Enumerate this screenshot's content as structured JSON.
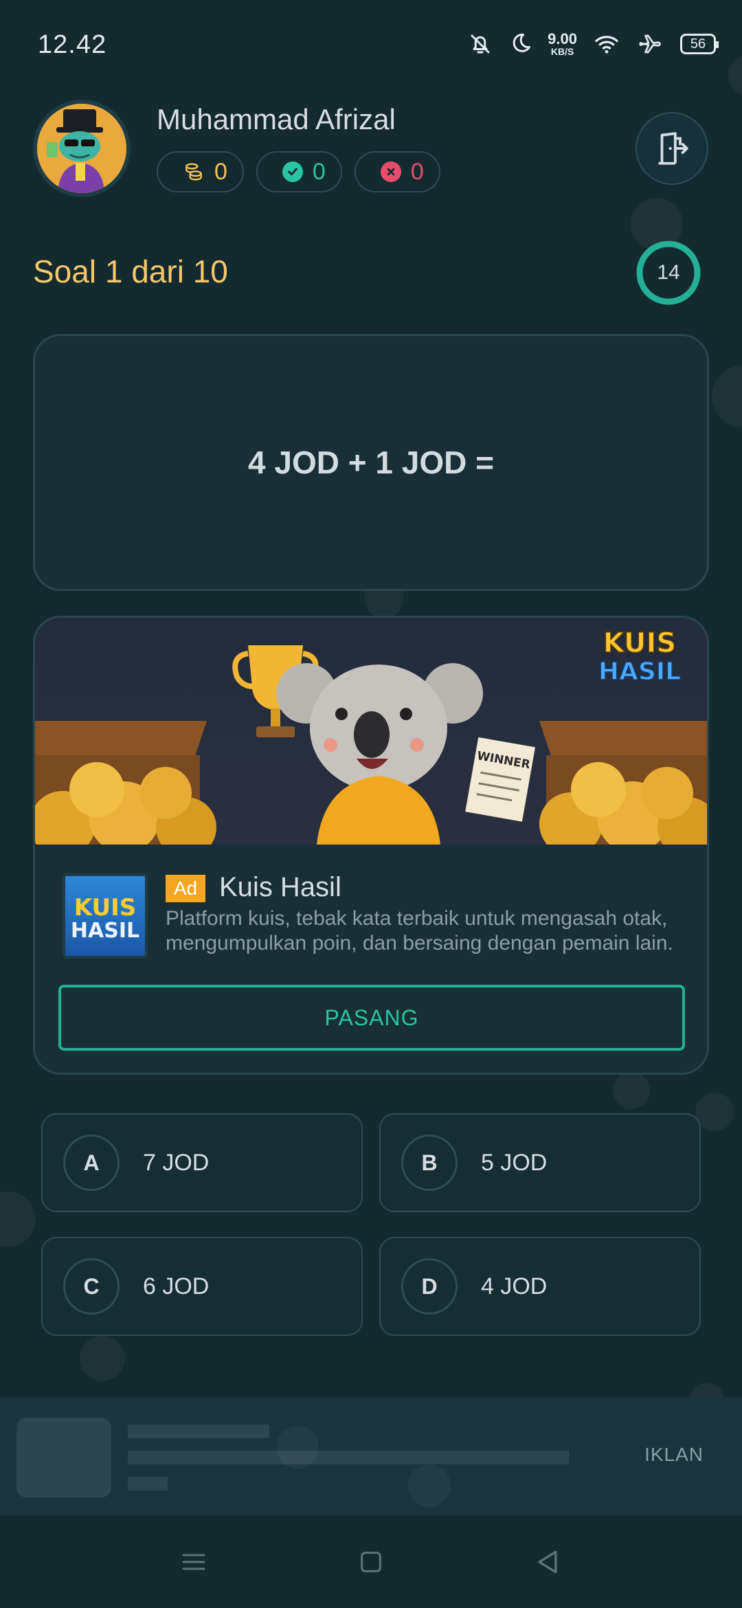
{
  "status_bar": {
    "time": "12.42",
    "net_speed_value": "9.00",
    "net_speed_unit": "KB/S",
    "battery": "56"
  },
  "profile": {
    "name": "Muhammad Afrizal",
    "coins": "0",
    "correct": "0",
    "wrong": "0"
  },
  "quiz": {
    "progress_label": "Soal 1 dari 10",
    "timer": "14",
    "question": "4 JOD + 1 JOD ="
  },
  "ad": {
    "badge": "Ad",
    "title": "Kuis Hasil",
    "description": "Platform kuis, tebak kata terbaik untuk mengasah otak, mengumpulkan poin, dan bersaing dengan pemain lain.",
    "install_label": "PASANG",
    "banner_sign": "WINNER",
    "logo_line1": "KUIS",
    "logo_line2": "HASIL"
  },
  "options": [
    {
      "letter": "A",
      "text": "7 JOD"
    },
    {
      "letter": "B",
      "text": "5 JOD"
    },
    {
      "letter": "C",
      "text": "6 JOD"
    },
    {
      "letter": "D",
      "text": "4 JOD"
    }
  ],
  "banner_ad": {
    "label": "IKLAN"
  },
  "colors": {
    "background": "#132a2f",
    "accent_teal": "#29c4a3",
    "accent_gold": "#f4c76c",
    "wrong_red": "#e64d6c"
  },
  "icons": [
    "bell-off-icon",
    "moon-icon",
    "wifi-icon",
    "airplane-icon",
    "battery-icon",
    "coins-icon",
    "check-circle-icon",
    "x-circle-icon",
    "exit-door-icon",
    "menu-icon",
    "home-square-icon",
    "back-triangle-icon"
  ]
}
